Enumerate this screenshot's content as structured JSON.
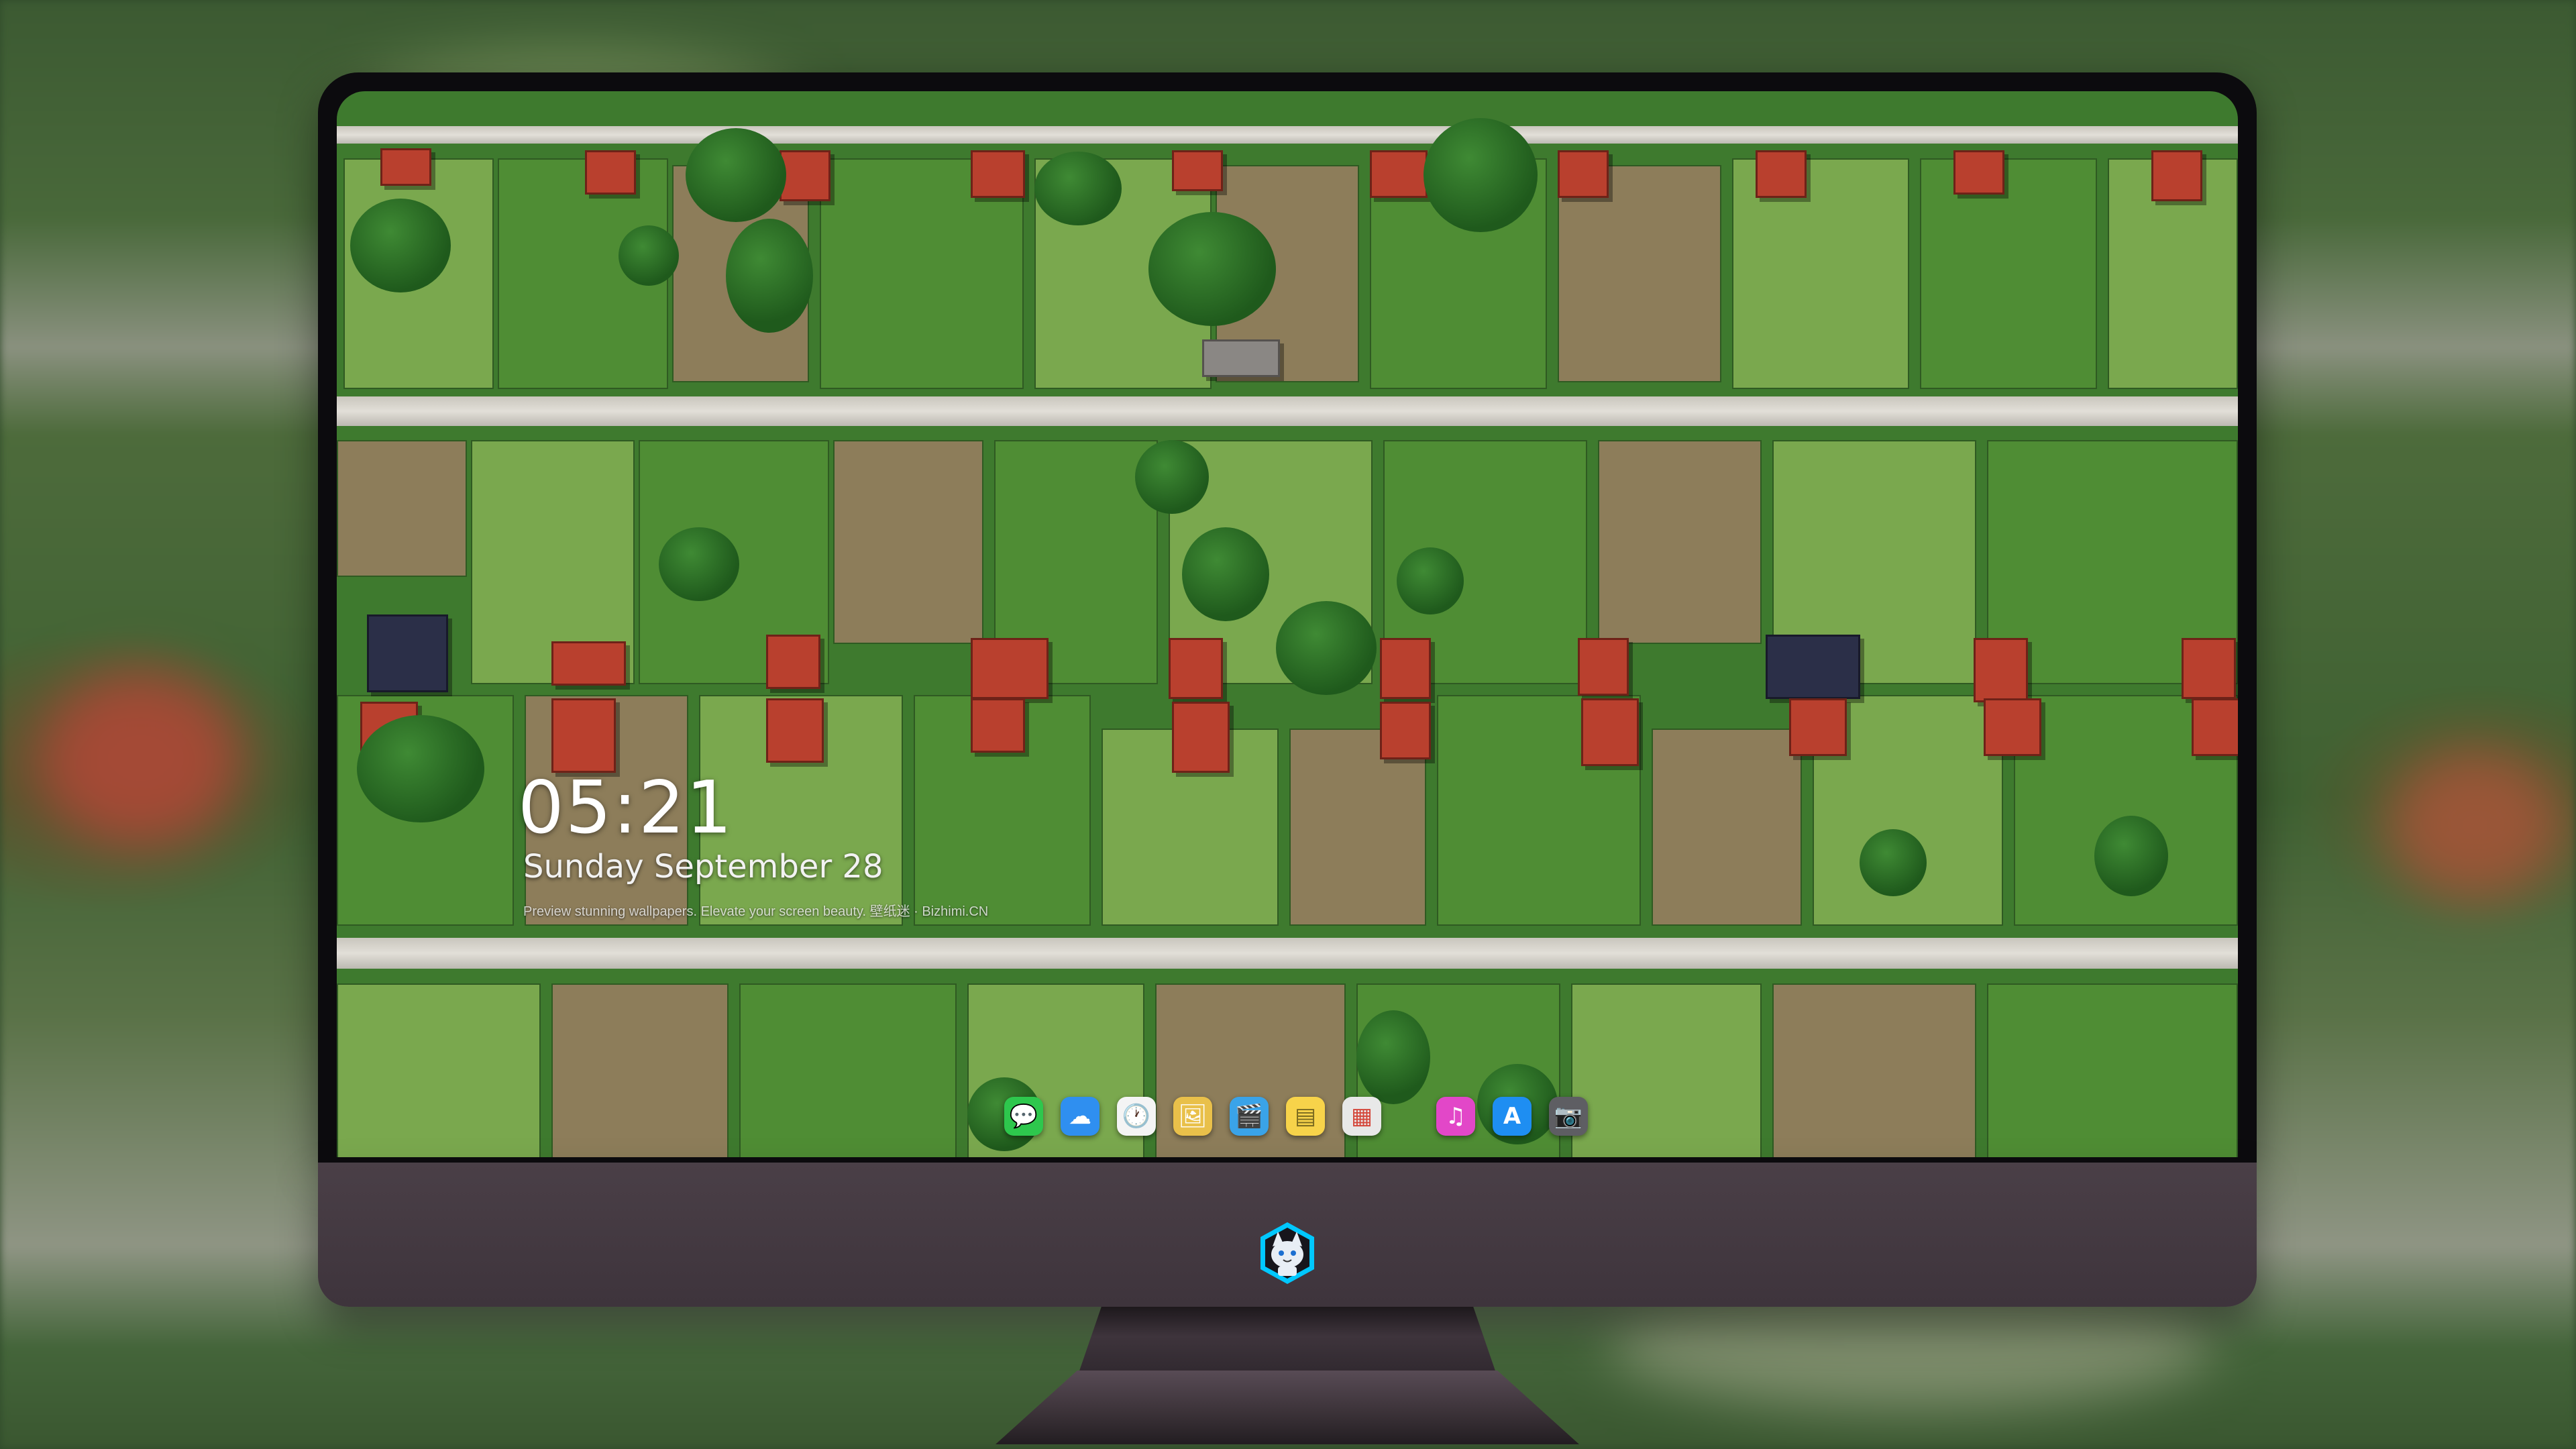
{
  "clock": {
    "time": "05:21",
    "date": "Sunday September  28",
    "tagline": "Preview stunning wallpapers. Elevate your screen beauty. 壁纸迷 · Bizhimi.CN"
  },
  "dock": {
    "apps": [
      {
        "name": "messages-icon",
        "glyph": "💬",
        "color": "#2ec74d"
      },
      {
        "name": "weather-icon",
        "glyph": "☁",
        "color": "#2f8ff0"
      },
      {
        "name": "clock-icon",
        "glyph": "🕐",
        "color": "#f4f4f4"
      },
      {
        "name": "preview-icon",
        "glyph": "🖼",
        "color": "#e9c04a"
      },
      {
        "name": "clips-icon",
        "glyph": "🎬",
        "color": "#3aa3e8"
      },
      {
        "name": "notes-icon",
        "glyph": "▤",
        "color": "#f7d34a"
      },
      {
        "name": "photo-booth-icon",
        "glyph": "▦",
        "color": "#e8e8e8"
      },
      {
        "name": "itunes-icon",
        "glyph": "♫",
        "color": "#e247c8"
      },
      {
        "name": "app-store-icon",
        "glyph": "A",
        "color": "#1e8ef2"
      },
      {
        "name": "screenshot-icon",
        "glyph": "📷",
        "color": "#5e5e63"
      }
    ]
  },
  "brand": {
    "logo": "cat-mascot-icon",
    "accent": "#00c8ff"
  }
}
